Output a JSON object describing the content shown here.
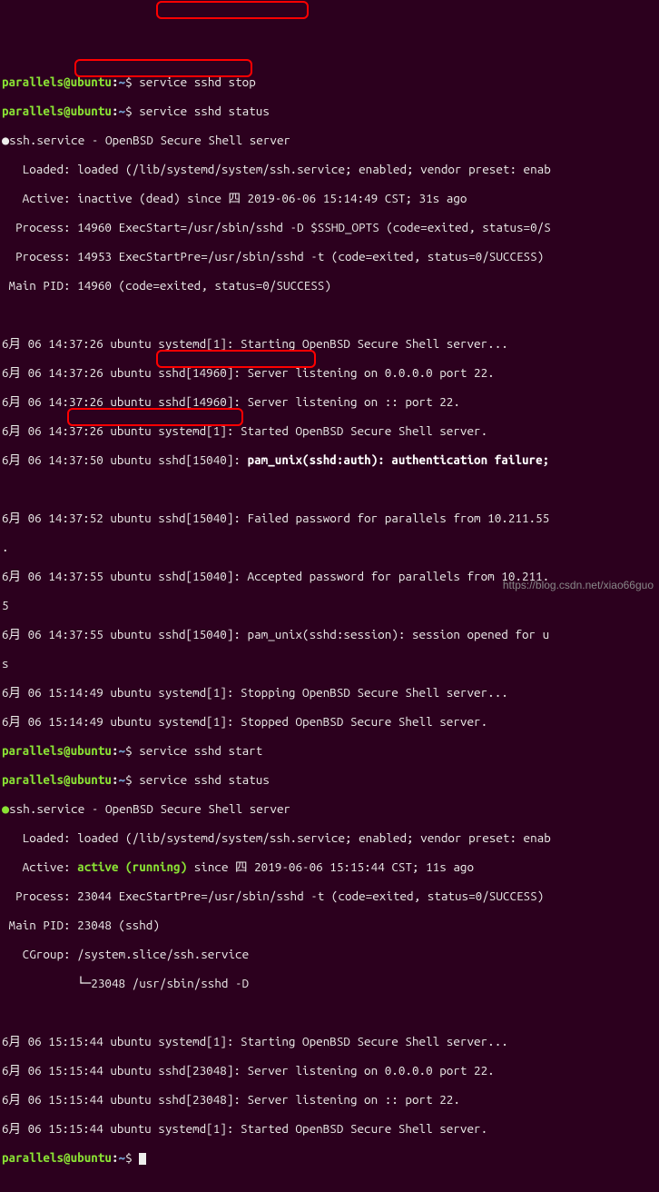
{
  "prompt": {
    "user": "parallels",
    "at": "@",
    "host": "ubuntu",
    "colon": ":",
    "path": "~",
    "dollar": "$ "
  },
  "cmds": {
    "stop": "service sshd stop",
    "status": "service sshd status",
    "start": "service sshd start"
  },
  "svc": {
    "header": "ssh.service - OpenBSD Secure Shell server",
    "loaded": "   Loaded: loaded (/lib/systemd/system/ssh.service; enabled; vendor preset: enab",
    "active_dead_pre": "   Active: ",
    "active_dead": "inactive (dead)",
    "active_dead_post": " since 四 2019-06-06 15:14:49 CST; 31s ago",
    "process1": "  Process: 14960 ExecStart=/usr/sbin/sshd -D $SSHD_OPTS (code=exited, status=0/S",
    "process2": "  Process: 14953 ExecStartPre=/usr/sbin/sshd -t (code=exited, status=0/SUCCESS)",
    "mainpid1": " Main PID: 14960 (code=exited, status=0/SUCCESS)",
    "active_run_pre": "   Active: ",
    "active_run": "active (running)",
    "active_run_post": " since 四 2019-06-06 15:15:44 CST; 11s ago",
    "process3": "  Process: 23044 ExecStartPre=/usr/sbin/sshd -t (code=exited, status=0/SUCCESS)",
    "mainpid2": " Main PID: 23048 (sshd)",
    "cgroup1": "   CGroup: /system.slice/ssh.service",
    "cgroup2": "           └─23048 /usr/sbin/sshd -D"
  },
  "logs": {
    "l1": "6月 06 14:37:26 ubuntu systemd[1]: Starting OpenBSD Secure Shell server...",
    "l2": "6月 06 14:37:26 ubuntu sshd[14960]: Server listening on 0.0.0.0 port 22.",
    "l3": "6月 06 14:37:26 ubuntu sshd[14960]: Server listening on :: port 22.",
    "l4": "6月 06 14:37:26 ubuntu systemd[1]: Started OpenBSD Secure Shell server.",
    "l5a": "6月 06 14:37:50 ubuntu sshd[15040]: ",
    "l5b": "pam_unix(sshd:auth): authentication failure;",
    "l6": "6月 06 14:37:52 ubuntu sshd[15040]: Failed password for parallels from 10.211.55",
    "l6dot": ".",
    "l7": "6月 06 14:37:55 ubuntu sshd[15040]: Accepted password for parallels from 10.211.",
    "l7n": "5",
    "l8": "6月 06 14:37:55 ubuntu sshd[15040]: pam_unix(sshd:session): session opened for u",
    "l8n": "s",
    "l9": "6月 06 15:14:49 ubuntu systemd[1]: Stopping OpenBSD Secure Shell server...",
    "l10": "6月 06 15:14:49 ubuntu systemd[1]: Stopped OpenBSD Secure Shell server.",
    "r1": "6月 06 15:15:44 ubuntu systemd[1]: Starting OpenBSD Secure Shell server...",
    "r2": "6月 06 15:15:44 ubuntu sshd[23048]: Server listening on 0.0.0.0 port 22.",
    "r3": "6月 06 15:15:44 ubuntu sshd[23048]: Server listening on :: port 22.",
    "r4": "6月 06 15:15:44 ubuntu systemd[1]: Started OpenBSD Secure Shell server."
  },
  "dot_dead": "●",
  "dot_run": "●",
  "blank": " ",
  "watermark": "https://blog.csdn.net/xiao66guo"
}
